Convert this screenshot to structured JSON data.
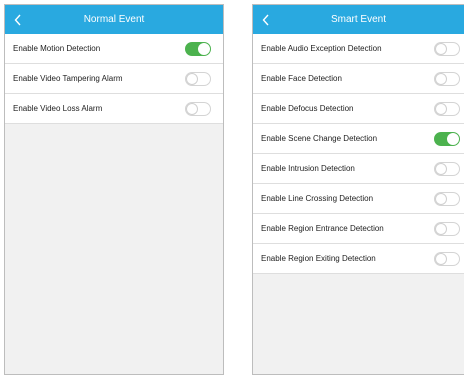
{
  "colors": {
    "navbar": "#29a9e0",
    "toggle_on": "#4cb24e",
    "background": "#f1f1f1"
  },
  "left_screen": {
    "title": "Normal Event",
    "back_icon": "chevron-left-icon",
    "items": [
      {
        "label": "Enable Motion Detection",
        "enabled": true
      },
      {
        "label": "Enable Video Tampering Alarm",
        "enabled": false
      },
      {
        "label": "Enable Video Loss Alarm",
        "enabled": false
      }
    ]
  },
  "right_screen": {
    "title": "Smart Event",
    "back_icon": "chevron-left-icon",
    "items": [
      {
        "label": "Enable Audio Exception Detection",
        "enabled": false
      },
      {
        "label": "Enable Face Detection",
        "enabled": false
      },
      {
        "label": "Enable Defocus Detection",
        "enabled": false
      },
      {
        "label": "Enable Scene Change Detection",
        "enabled": true
      },
      {
        "label": "Enable Intrusion Detection",
        "enabled": false
      },
      {
        "label": "Enable Line Crossing Detection",
        "enabled": false
      },
      {
        "label": "Enable Region Entrance Detection",
        "enabled": false
      },
      {
        "label": "Enable Region Exiting Detection",
        "enabled": false
      }
    ]
  }
}
